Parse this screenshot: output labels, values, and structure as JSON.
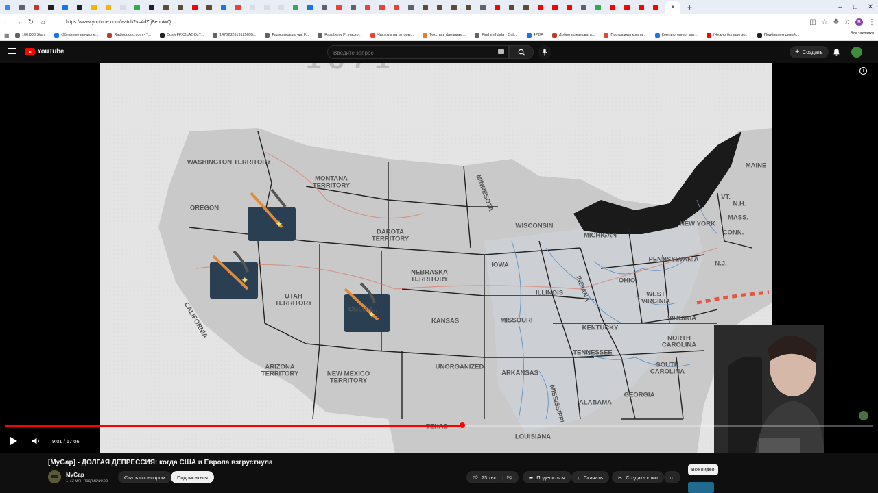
{
  "browser": {
    "tab_colors": [
      "#4285f4",
      "#5f6368",
      "#c0392b",
      "#202124",
      "#1a73e8",
      "#202124",
      "#f4b400",
      "#f4b400",
      "#dadce0",
      "#34a853",
      "#202124",
      "#5f4b32",
      "#5f4b32",
      "#ff0000",
      "#5f4b32",
      "#1a73e8",
      "#ea4335",
      "#dadce0",
      "#dadce0",
      "#dadce0",
      "#34a853",
      "#1a73e8",
      "#5f6368",
      "#ea4335",
      "#5f6368",
      "#ea4335",
      "#ea4335",
      "#ea4335",
      "#5f6368",
      "#5f4b32",
      "#5f4b32",
      "#5f4b32",
      "#5f4b32",
      "#5f6368",
      "#ff0000",
      "#5f4b32",
      "#5f4b32",
      "#ff0000",
      "#ff0000",
      "#ff0000",
      "#5f6368",
      "#34a853",
      "#ff0000",
      "#ff0000",
      "#ff0000",
      "#ff0000"
    ],
    "url": "https://www.youtube.com/watch?v=4dZfjBebnWQ",
    "profile_letter": "B",
    "bookmarks": [
      {
        "label": "100,000 Stars",
        "color": "#5f6368"
      },
      {
        "label": "Облачные вычисле...",
        "color": "#1a73e8"
      },
      {
        "label": "Radioooooo.com - T...",
        "color": "#c0392b"
      },
      {
        "label": "CgsMFFXXgAQQzT...",
        "color": "#202124"
      },
      {
        "label": "1476282613125095...",
        "color": "#5f6368"
      },
      {
        "label": "Радиопередатчик F...",
        "color": "#5f6368"
      },
      {
        "label": "Raspberry Pi: настр...",
        "color": "#5f6368"
      },
      {
        "label": "Частоты на которы...",
        "color": "#ea4335"
      },
      {
        "label": "Тексты в фильмах:...",
        "color": "#e67e22"
      },
      {
        "label": "Find exif data - Onli...",
        "color": "#5f6368"
      },
      {
        "label": "4PDA",
        "color": "#1a73e8"
      },
      {
        "label": "Добро пожаловать...",
        "color": "#c0392b"
      },
      {
        "label": "Программы компа...",
        "color": "#ea4335"
      },
      {
        "label": "Компьютерная кри...",
        "color": "#1a73e8"
      },
      {
        "label": "(Нужно больше зо...",
        "color": "#ff0000"
      },
      {
        "label": "Подбираем дизайс...",
        "color": "#202124"
      }
    ],
    "all_bookmarks": "Все закладки"
  },
  "youtube": {
    "logo_text": "YouTube",
    "search_placeholder": "Введите запрос",
    "create_label": "Создать"
  },
  "player": {
    "time_current": "9:01",
    "time_total": "17:06",
    "progress": 0.527,
    "map_labels": {
      "washington": "WASHINGTON TERRITORY",
      "oregon": "OREGON",
      "montana": "MONTANA TERRITORY",
      "dakota": "DAKOTA TERRITORY",
      "minnesota": "MINNESOTA",
      "wisconsin": "WISCONSIN",
      "michigan": "MICHIGAN",
      "maine": "MAINE",
      "newyork": "NEW YORK",
      "vt": "VT.",
      "nh": "N.H.",
      "mass": "MASS.",
      "conn": "CONN.",
      "pennsylvania": "PENNSYLVANIA",
      "nj": "N.J.",
      "iowa": "IOWA",
      "nebraska": "NEBRASKA TERRITORY",
      "utah": "UTAH TERRITORY",
      "california": "CALIFORNIA",
      "colorado": "COLOR...",
      "kansas": "KANSAS",
      "illinois": "ILLINOIS",
      "indiana": "INDIANA",
      "ohio": "OHIO",
      "westvirginia": "WEST VIRGINIA",
      "virginia": "VIRGINIA",
      "missouri": "MISSOURI",
      "kentucky": "KENTUCKY",
      "arizona": "ARIZONA TERRITORY",
      "newmexico": "NEW MEXICO TERRITORY",
      "unorganized": "UNORGANIZED",
      "arkansas": "ARKANSAS",
      "tennessee": "TENNESSEE",
      "northcarolina": "NORTH CAROLINA",
      "southcarolina": "SOUTH CAROLINA",
      "mississippi": "MISSISSIPPI",
      "alabama": "ALABAMA",
      "georgia": "GEORGIA",
      "texas": "TEXAS",
      "louisiana": "LOUISIANA"
    }
  },
  "video": {
    "title": "[MyGap] - ДОЛГАЯ ДЕПРЕССИЯ: когда США и Европа взгрустнула",
    "channel": "MyGap",
    "subscribers": "1,73 млн подписчиков",
    "sponsor_label": "Стать спонсором",
    "subscribe_label": "Подписаться",
    "likes": "23 тыс.",
    "share_label": "Поделиться",
    "download_label": "Скачать",
    "clip_label": "Создать клип",
    "all_videos_label": "Все видео"
  }
}
